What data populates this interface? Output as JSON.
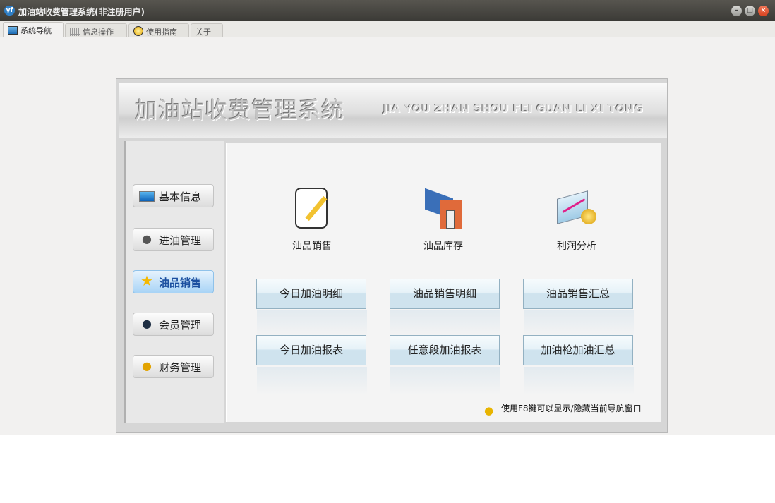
{
  "window": {
    "title": "加油站收费管理系统(非注册用户)",
    "logo": "yf"
  },
  "tabs": [
    {
      "label": "系统导航",
      "icon": "monitor-icon"
    },
    {
      "label": "信息操作",
      "icon": "grid-icon"
    },
    {
      "label": "使用指南",
      "icon": "help-icon"
    },
    {
      "label": "关于",
      "icon": ""
    }
  ],
  "header": {
    "title_cn": "加油站收费管理系统",
    "title_en": "JIA YOU ZHAN SHOU FEI GUAN LI XI TONG"
  },
  "sidebar": [
    {
      "label": "基本信息",
      "icon": "monitor-icon"
    },
    {
      "label": "进油管理",
      "icon": "user-icon"
    },
    {
      "label": "油品销售",
      "icon": "star-icon",
      "active": true
    },
    {
      "label": "会员管理",
      "icon": "person-suit-icon"
    },
    {
      "label": "财务管理",
      "icon": "coins-icon"
    }
  ],
  "modules": [
    {
      "label": "油品销售",
      "icon": "edit-icon"
    },
    {
      "label": "油品库存",
      "icon": "warehouse-icon"
    },
    {
      "label": "利润分析",
      "icon": "chart-coins-icon"
    }
  ],
  "actions": [
    "今日加油明细",
    "油品销售明细",
    "油品销售汇总",
    "今日加油报表",
    "任意段加油报表",
    "加油枪加油汇总"
  ],
  "hint": "使用F8键可以显示/隐藏当前导航窗口"
}
